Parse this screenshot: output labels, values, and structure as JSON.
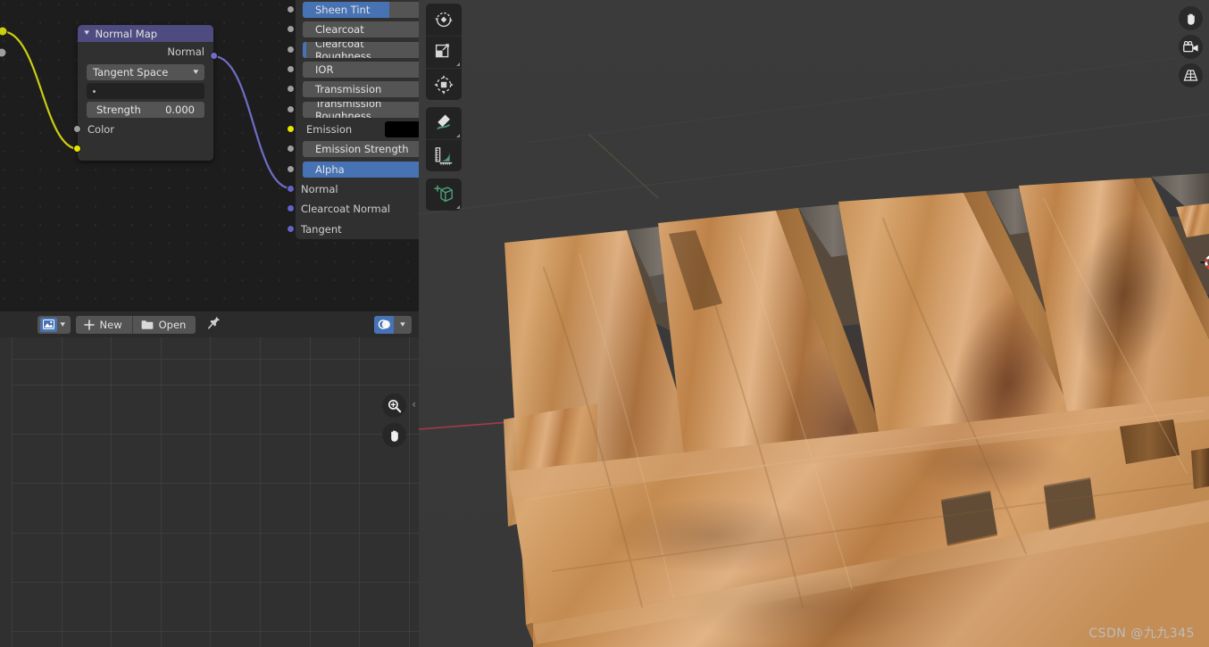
{
  "app": "Blender",
  "node_editor": {
    "name": "shader-node-editor",
    "normal_map_node": {
      "title": "Normal Map",
      "output_label": "Normal",
      "space_dropdown": "Tangent Space",
      "uv_map_value": "",
      "strength_label": "Strength",
      "strength_value": "0.000",
      "color_input_label": "Color",
      "header_color": "#4d4b80"
    },
    "bsdf_node": {
      "rows": [
        {
          "label": "Sheen Tint",
          "kind": "slider",
          "fill": 0.72,
          "socket": "#9e9e9e"
        },
        {
          "label": "Clearcoat",
          "kind": "slider",
          "fill": 0.0,
          "socket": "#9e9e9e"
        },
        {
          "label": "Clearcoat Roughness",
          "kind": "slider",
          "fill": 0.03,
          "socket": "#9e9e9e"
        },
        {
          "label": "IOR",
          "kind": "slider",
          "fill": 0.0,
          "socket": "#9e9e9e"
        },
        {
          "label": "Transmission",
          "kind": "slider",
          "fill": 0.0,
          "socket": "#9e9e9e"
        },
        {
          "label": "Transmission Roughness",
          "kind": "slider",
          "fill": 0.0,
          "socket": "#9e9e9e"
        },
        {
          "label": "Emission",
          "kind": "color",
          "swatch": "#000000",
          "socket": "#e6e600"
        },
        {
          "label": "Emission Strength",
          "kind": "slider",
          "fill": 0.0,
          "socket": "#9e9e9e"
        },
        {
          "label": "Alpha",
          "kind": "slider",
          "fill": 1.0,
          "socket": "#9e9e9e"
        },
        {
          "label": "Normal",
          "kind": "plain",
          "socket": "#6363c7"
        },
        {
          "label": "Clearcoat Normal",
          "kind": "plain",
          "socket": "#6363c7"
        },
        {
          "label": "Tangent",
          "kind": "plain",
          "socket": "#6363c7"
        }
      ],
      "slider_fill_color": "#4772b3"
    },
    "links": [
      {
        "name": "color-link",
        "color": "#cdcd12"
      },
      {
        "name": "normal-link",
        "color": "#6e6ec8"
      }
    ]
  },
  "image_editor": {
    "name": "image-editor",
    "image_selector_label": "",
    "new_button": "New",
    "open_button": "Open",
    "pin_tooltip": "",
    "view_mode": "",
    "zoom_gizmo": "zoom",
    "pan_gizmo": "pan"
  },
  "viewport": {
    "name": "3d-viewport",
    "tools": [
      {
        "name": "tool-rotate",
        "label": "Rotate"
      },
      {
        "name": "tool-scale",
        "label": "Scale"
      },
      {
        "name": "tool-transform",
        "label": "Transform"
      },
      {
        "name": "tool-annotate",
        "label": "Annotate"
      },
      {
        "name": "tool-measure",
        "label": "Measure"
      },
      {
        "name": "tool-add-cube",
        "label": "Add Cube"
      }
    ],
    "gizmos": [
      {
        "name": "move-view-gizmo",
        "label": "Move View"
      },
      {
        "name": "camera-view-gizmo",
        "label": "Camera View"
      },
      {
        "name": "toggle-perspective-gizmo",
        "label": "Toggle Perspective"
      }
    ],
    "axis_x_color": "#a33b4a",
    "axis_y_color": "#5b9b24",
    "background_color": "#3a3a3a",
    "object": "wooden pallet",
    "cursor_3d": "3d-cursor",
    "origin_color": "#ff8a1e"
  },
  "watermark": "CSDN @九九345"
}
